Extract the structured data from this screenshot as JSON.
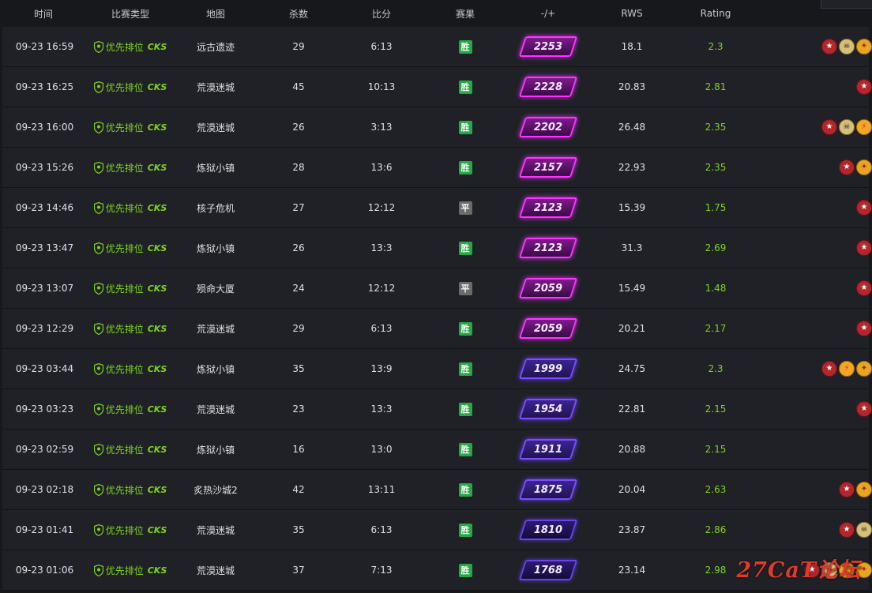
{
  "header": {
    "time": "时间",
    "type": "比赛类型",
    "map": "地图",
    "kills": "杀数",
    "score": "比分",
    "result": "赛果",
    "elo_change": "-/+",
    "rws": "RWS",
    "rating": "Rating"
  },
  "type_label": "优先排位",
  "cs_logo": "CKS",
  "matches": [
    {
      "time": "09-23 16:59",
      "map": "远古遗迹",
      "kills": "29",
      "score": "6:13",
      "result": "胜",
      "result_kind": "win",
      "elo": "2253",
      "elo_color": "magenta",
      "rws": "18.1",
      "rating": "2.3",
      "medals": [
        "star-icon",
        "skull-icon",
        "knife-icon"
      ]
    },
    {
      "time": "09-23 16:25",
      "map": "荒漠迷城",
      "kills": "45",
      "score": "10:13",
      "result": "胜",
      "result_kind": "win",
      "elo": "2228",
      "elo_color": "magenta",
      "rws": "20.83",
      "rating": "2.81",
      "medals": [
        "star-icon"
      ]
    },
    {
      "time": "09-23 16:00",
      "map": "荒漠迷城",
      "kills": "26",
      "score": "3:13",
      "result": "胜",
      "result_kind": "win",
      "elo": "2202",
      "elo_color": "magenta",
      "rws": "26.48",
      "rating": "2.35",
      "medals": [
        "star-icon",
        "skull-icon",
        "fire-icon"
      ]
    },
    {
      "time": "09-23 15:26",
      "map": "炼狱小镇",
      "kills": "28",
      "score": "13:6",
      "result": "胜",
      "result_kind": "win",
      "elo": "2157",
      "elo_color": "magenta",
      "rws": "22.93",
      "rating": "2.35",
      "medals": [
        "star-icon",
        "knife-icon"
      ]
    },
    {
      "time": "09-23 14:46",
      "map": "核子危机",
      "kills": "27",
      "score": "12:12",
      "result": "平",
      "result_kind": "draw",
      "elo": "2123",
      "elo_color": "magenta",
      "rws": "15.39",
      "rating": "1.75",
      "medals": [
        "star-icon"
      ]
    },
    {
      "time": "09-23 13:47",
      "map": "炼狱小镇",
      "kills": "26",
      "score": "13:3",
      "result": "胜",
      "result_kind": "win",
      "elo": "2123",
      "elo_color": "magenta",
      "rws": "31.3",
      "rating": "2.69",
      "medals": [
        "star-icon"
      ]
    },
    {
      "time": "09-23 13:07",
      "map": "殒命大厦",
      "kills": "24",
      "score": "12:12",
      "result": "平",
      "result_kind": "draw",
      "elo": "2059",
      "elo_color": "magenta",
      "rws": "15.49",
      "rating": "1.48",
      "medals": [
        "star-icon"
      ]
    },
    {
      "time": "09-23 12:29",
      "map": "荒漠迷城",
      "kills": "29",
      "score": "6:13",
      "result": "胜",
      "result_kind": "win",
      "elo": "2059",
      "elo_color": "magenta",
      "rws": "20.21",
      "rating": "2.17",
      "medals": [
        "star-icon"
      ]
    },
    {
      "time": "09-23 03:44",
      "map": "炼狱小镇",
      "kills": "35",
      "score": "13:9",
      "result": "胜",
      "result_kind": "win",
      "elo": "1999",
      "elo_color": "purple",
      "rws": "24.75",
      "rating": "2.3",
      "medals": [
        "star-icon",
        "fire-icon",
        "knife-icon"
      ]
    },
    {
      "time": "09-23 03:23",
      "map": "荒漠迷城",
      "kills": "23",
      "score": "13:3",
      "result": "胜",
      "result_kind": "win",
      "elo": "1954",
      "elo_color": "purple",
      "rws": "22.81",
      "rating": "2.15",
      "medals": [
        "star-icon"
      ]
    },
    {
      "time": "09-23 02:59",
      "map": "炼狱小镇",
      "kills": "16",
      "score": "13:0",
      "result": "胜",
      "result_kind": "win",
      "elo": "1911",
      "elo_color": "purple",
      "rws": "20.88",
      "rating": "2.15",
      "medals": []
    },
    {
      "time": "09-23 02:18",
      "map": "炙热沙城2",
      "kills": "42",
      "score": "13:11",
      "result": "胜",
      "result_kind": "win",
      "elo": "1875",
      "elo_color": "purple",
      "rws": "20.04",
      "rating": "2.63",
      "medals": [
        "star-icon",
        "knife-icon"
      ]
    },
    {
      "time": "09-23 01:41",
      "map": "荒漠迷城",
      "kills": "35",
      "score": "6:13",
      "result": "胜",
      "result_kind": "win",
      "elo": "1810",
      "elo_color": "dpurple",
      "rws": "23.87",
      "rating": "2.86",
      "medals": [
        "star-icon",
        "skull-icon"
      ]
    },
    {
      "time": "09-23 01:06",
      "map": "荒漠迷城",
      "kills": "37",
      "score": "7:13",
      "result": "胜",
      "result_kind": "win",
      "elo": "1768",
      "elo_color": "dpurple",
      "rws": "23.14",
      "rating": "2.98",
      "medals": [
        "star-icon",
        "skull-icon",
        "fire-icon",
        "knife-icon"
      ]
    }
  ],
  "watermark": "27CaT论坛"
}
